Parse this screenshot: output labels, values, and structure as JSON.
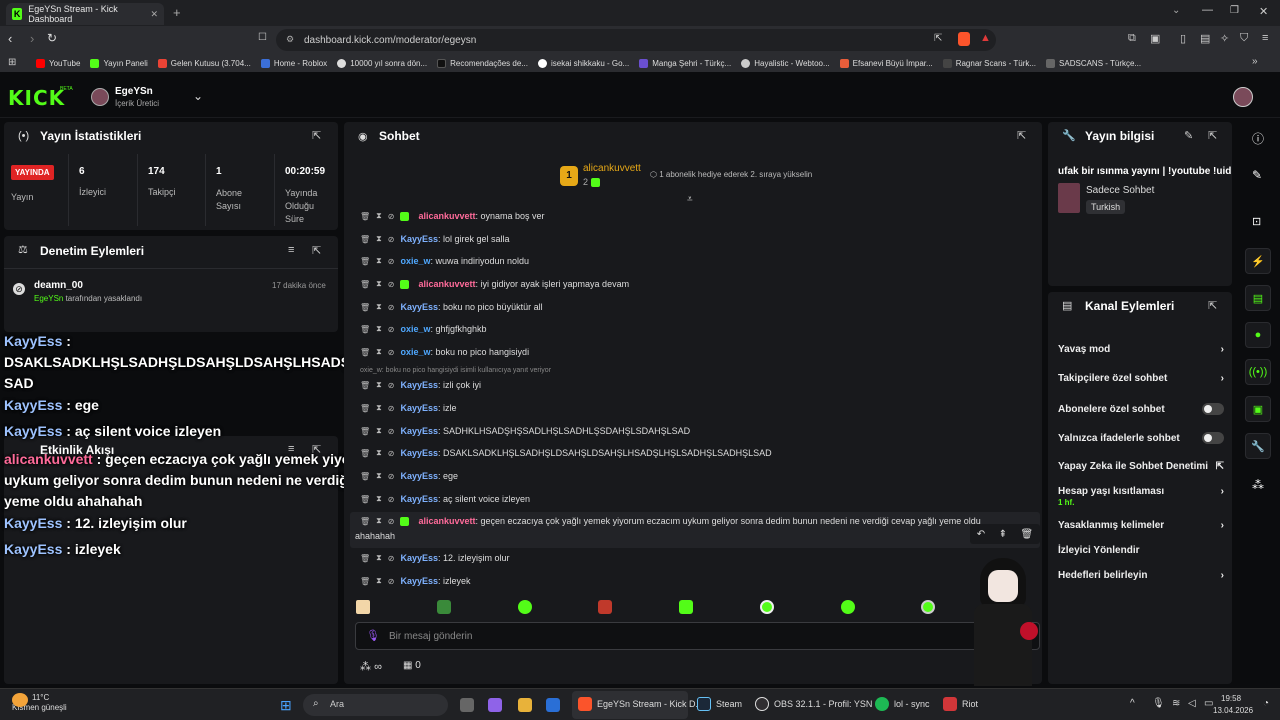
{
  "browser": {
    "tab_title": "EgeYSn Stream - Kick Dashboard",
    "url": "dashboard.kick.com/moderator/egeysn",
    "bookmarks": [
      "YouTube",
      "Yayın Paneli",
      "Gelen Kutusu (3.704...",
      "Home - Roblox",
      "10000 yıl sonra dön...",
      "Recomendações de...",
      "isekai shikkaku - Go...",
      "Manga Şehri - Türkç...",
      "Hayalistic - Webtoo...",
      "Efsanevi Büyü İmpar...",
      "Ragnar Scans - Türk...",
      "SADSCANS - Türkçe..."
    ]
  },
  "header": {
    "logo": "KICK",
    "beta": "BETA",
    "channel_name": "EgeYSn",
    "channel_role": "İçerik Üretici"
  },
  "stats": {
    "title": "Yayın İstatistikleri",
    "live_badge": "YAYINDA",
    "live_label": "Yayın",
    "viewers_value": "6",
    "viewers_label": "İzleyici",
    "followers_value": "174",
    "followers_label": "Takipçi",
    "subs_value": "1",
    "subs_label": "Abone Sayısı",
    "duration_value": "00:20:59",
    "duration_label": "Yayında Olduğu Süre"
  },
  "moderation": {
    "title": "Denetim Eylemleri",
    "user": "deamn_00",
    "time": "17 dakika önce",
    "actor": "EgeYSn",
    "desc": " tarafından yasaklandı"
  },
  "activity": {
    "title": "Etkinlik Akışı"
  },
  "overlay": [
    {
      "user": "KayyEss",
      "text": " : DSAKLSADKLHŞLSADHŞLDSAHŞLDSAHŞLHSADŞLHŞLSADHŞLSADHŞL SAD"
    },
    {
      "user": "KayyEss",
      "text": " : ege"
    },
    {
      "user": "KayyEss",
      "text": " : aç silent voice izleyen"
    },
    {
      "user": "alicankuvvett",
      "text": " : geçen eczacıya çok yağlı yemek yiyorum eczacım uykum geliyor sonra dedim bunun nedeni ne verdiği cevap yağlı yeme oldu ahahahah"
    },
    {
      "user": "KayyEss",
      "text": " : 12. izleyişim olur"
    },
    {
      "user": "KayyEss",
      "text": " : izleyek"
    }
  ],
  "chat": {
    "title": "Sohbet",
    "pinned_user": "alicankuvvett",
    "pinned_rank": "1",
    "pinned_count": "2",
    "pinned_text": "1 abonelik hediye ederek 2. sıraya yükselin",
    "reply_hint": "oxie_w: boku no pico hangisiydi isimli kullanıcıya yanıt veriyor",
    "messages": [
      {
        "user": "alicankuvvett",
        "text": ": oynama boş ver"
      },
      {
        "user": "KayyEss",
        "text": ": lol girek gel salla"
      },
      {
        "user": "oxie_w",
        "text": ": wuwa indiriyodun noldu"
      },
      {
        "user": "alicankuvvett",
        "text": ": iyi gidiyor ayak işleri yapmaya devam"
      },
      {
        "user": "KayyEss",
        "text": ": boku no pico büyüktür all"
      },
      {
        "user": "oxie_w",
        "text": ": ghfjgfkhghkb"
      },
      {
        "user": "oxie_w",
        "text": ": boku no pico hangisiydi"
      },
      {
        "user": "KayyEss",
        "text": ": izli çok iyi"
      },
      {
        "user": "KayyEss",
        "text": ": izle"
      },
      {
        "user": "KayyEss",
        "text": ": SADHKLHSADŞHŞSADLHŞLSADHLŞSDAHŞLSDAHŞLSAD"
      },
      {
        "user": "KayyEss",
        "text": ": DSAKLSADKLHŞLSADHŞLDSAHŞLDSAHŞLHSADŞLHŞLSADHŞLSADHŞLSAD"
      },
      {
        "user": "KayyEss",
        "text": ": ege"
      },
      {
        "user": "KayyEss",
        "text": ": aç silent voice izleyen"
      },
      {
        "user": "alicankuvvett",
        "text": ": geçen eczacıya çok yağlı yemek yiyorum eczacım uykum geliyor sonra dedim bunun nedeni ne verdiği cevap yağlı yeme oldu",
        "cont": "ahahahah"
      },
      {
        "user": "KayyEss",
        "text": ": 12. izleyişim olur"
      },
      {
        "user": "KayyEss",
        "text": ": izleyek"
      }
    ],
    "input_placeholder": "Bir mesaj gönderin",
    "points": "∞",
    "store_count": "0"
  },
  "stream_info": {
    "title": "Yayın bilgisi",
    "stream_title": "ufak bir ısınma yayını | !youtube !uid",
    "category": "Sadece Sohbet",
    "tag": "Turkish"
  },
  "channel_actions": {
    "title": "Kanal Eylemleri",
    "items": [
      {
        "label": "Yavaş mod"
      },
      {
        "label": "Takipçilere özel sohbet"
      },
      {
        "label": "Abonelere özel sohbet"
      },
      {
        "label": "Yalnızca ifadelerle sohbet"
      },
      {
        "label": "Yapay Zeka ile Sohbet Denetimi"
      },
      {
        "label": "Hesap yaşı kısıtlaması",
        "sub": "1 hf."
      },
      {
        "label": "Yasaklanmış kelimeler"
      },
      {
        "label": "İzleyici Yönlendir"
      },
      {
        "label": "Hedefleri belirleyin"
      }
    ]
  },
  "taskbar": {
    "weather_temp": "11°C",
    "weather_desc": "Kısmen güneşli",
    "search": "Ara",
    "apps": [
      "EgeYSn Stream - Kick D...",
      "Steam",
      "OBS 32.1.1 - Profil: YSN -",
      "lol - sync",
      "Riot"
    ],
    "time": "19:58",
    "date": "13.04.2026"
  }
}
